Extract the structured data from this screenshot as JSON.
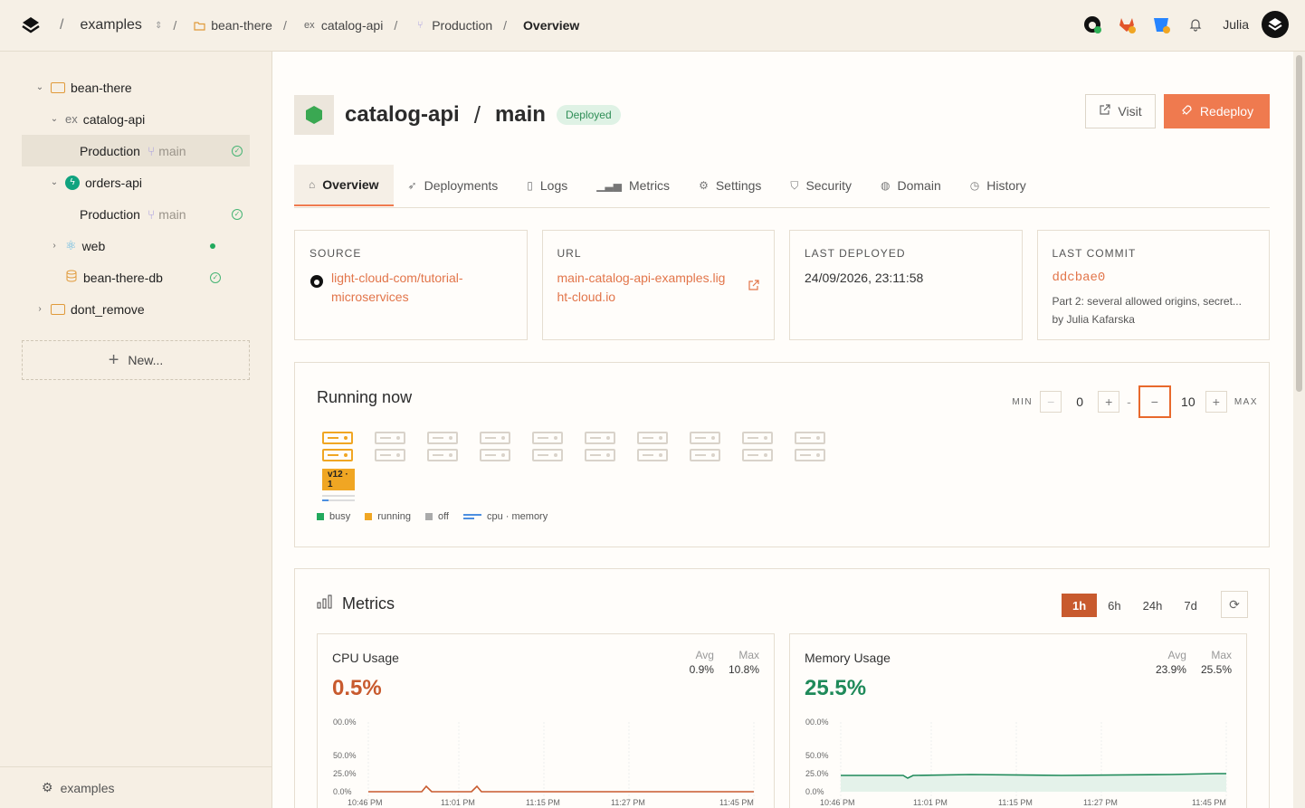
{
  "breadcrumbs": {
    "workspace": "examples",
    "project": "bean-there",
    "service": "catalog-api",
    "environment": "Production",
    "page": "Overview",
    "separator": "/"
  },
  "user": {
    "name": "Julia"
  },
  "sidebar": {
    "tree": [
      {
        "label": "bean-there"
      },
      {
        "label": "catalog-api"
      },
      {
        "label": "Production",
        "branch": "main"
      },
      {
        "label": "orders-api"
      },
      {
        "label": "Production",
        "branch": "main"
      },
      {
        "label": "web"
      },
      {
        "label": "bean-there-db"
      },
      {
        "label": "dont_remove"
      }
    ],
    "new_label": "New...",
    "footer_label": "examples"
  },
  "header": {
    "service": "catalog-api",
    "branch": "main",
    "status": "Deployed",
    "visit_label": "Visit",
    "redeploy_label": "Redeploy"
  },
  "tabs": [
    {
      "label": "Overview"
    },
    {
      "label": "Deployments"
    },
    {
      "label": "Logs"
    },
    {
      "label": "Metrics"
    },
    {
      "label": "Settings"
    },
    {
      "label": "Security"
    },
    {
      "label": "Domain"
    },
    {
      "label": "History"
    }
  ],
  "cards": {
    "source": {
      "label": "SOURCE",
      "value_line1": "light-cloud-com/tutorial-",
      "value_line2": "microservices"
    },
    "url": {
      "label": "URL",
      "value_line1": "main-catalog-api-examples.lig",
      "value_line2": "ht-cloud.io"
    },
    "deployed": {
      "label": "LAST DEPLOYED",
      "value": "24/09/2026, 23:11:58"
    },
    "commit": {
      "label": "LAST COMMIT",
      "hash": "ddcbae0",
      "message": "Part 2: several allowed origins, secret...",
      "author": "by Julia Kafarska"
    }
  },
  "running": {
    "title": "Running now",
    "min_label": "MIN",
    "min_value": "0",
    "max_label": "MAX",
    "max_value": "10",
    "dash": "-",
    "version_badge": "v12 · 1",
    "legend": {
      "busy": "busy",
      "running": "running",
      "off": "off",
      "cpu_memory": "cpu · memory"
    }
  },
  "metrics": {
    "title": "Metrics",
    "ranges": [
      "1h",
      "6h",
      "24h",
      "7d"
    ],
    "cpu": {
      "title": "CPU Usage",
      "value": "0.5%",
      "avg_label": "Avg",
      "avg": "0.9%",
      "max_label": "Max",
      "max": "10.8%"
    },
    "memory": {
      "title": "Memory Usage",
      "value": "25.5%",
      "avg_label": "Avg",
      "avg": "23.9%",
      "max_label": "Max",
      "max": "25.5%"
    },
    "y_ticks": [
      "00.0%",
      "50.0%",
      "25.0%",
      "0.0%"
    ],
    "x_ticks": [
      "10:46 PM",
      "11:01 PM",
      "11:15 PM",
      "11:27 PM",
      "11:45 PM"
    ]
  },
  "colors": {
    "accent": "#ef7a4f",
    "cpu_line": "#c85a2e",
    "memory_line": "#1f8a5a",
    "running": "#f0a623",
    "busy": "#22a95d"
  }
}
